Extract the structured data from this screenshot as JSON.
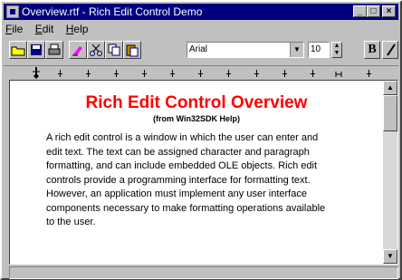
{
  "window": {
    "title": "Overview.rtf - Rich Edit Control Demo"
  },
  "menu": {
    "items": [
      {
        "label": "File"
      },
      {
        "label": "Edit"
      },
      {
        "label": "Help"
      }
    ]
  },
  "toolbar": {
    "font_name": "Arial",
    "font_size": "10",
    "bold_label": "B"
  },
  "document": {
    "title": "Rich Edit Control Overview",
    "subtitle": "(from Win32SDK Help)",
    "body": "A rich edit control is a window in which the user can enter and edit text. The text can be assigned character and paragraph formatting, and can include embedded OLE objects. Rich edit controls provide a programming interface for formatting text. However, an application must implement any user interface components necessary to make formatting operations available to the user."
  },
  "colors": {
    "title_bar": "#000080",
    "doc_title": "#ff0000"
  },
  "icons": [
    "open-icon",
    "save-icon",
    "print-icon",
    "highlighter-icon",
    "cut-icon",
    "copy-icon",
    "paste-icon",
    "italic-icon"
  ]
}
